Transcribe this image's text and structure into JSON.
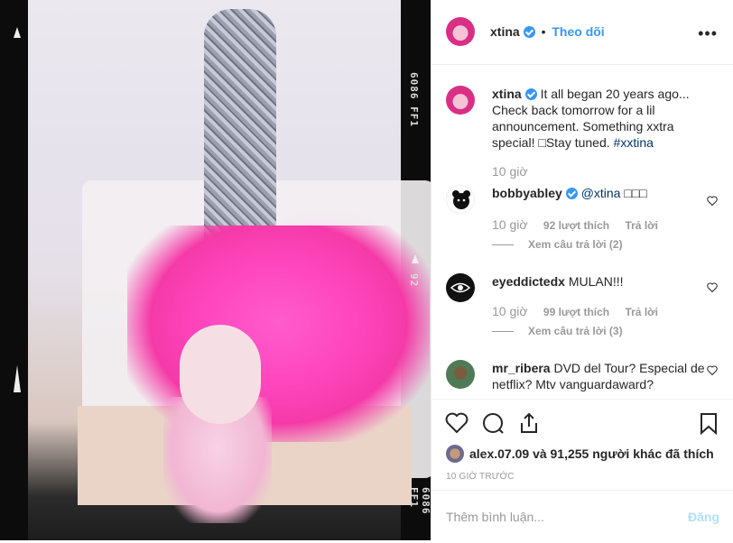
{
  "header": {
    "username": "xtina",
    "separator": "•",
    "follow_label": "Theo dõi",
    "more_label": "•••"
  },
  "film": {
    "top_code": "6086 FF1",
    "mid_code": "92",
    "bottom_code": "6086 FF1"
  },
  "caption": {
    "username": "xtina",
    "text": "It all began 20 years ago... Check back tomorrow for a lil announcement. Something xxtra special! □Stay tuned.",
    "hashtag": "#xxtina",
    "time": "10 giờ"
  },
  "comments": [
    {
      "username": "bobbyabley",
      "mention": "@xtina",
      "text": "□□□",
      "time": "10 giờ",
      "likes": "92 lượt thích",
      "reply_label": "Trả lời",
      "view_replies": "Xem câu trả lời (2)"
    },
    {
      "username": "eyeddictedx",
      "text": "MULAN!!!",
      "time": "10 giờ",
      "likes": "99 lượt thích",
      "reply_label": "Trả lời",
      "view_replies": "Xem câu trả lời (3)"
    },
    {
      "username": "mr_ribera",
      "text": "DVD del Tour? Especial de netflix? Mtv vanguardaward?"
    }
  ],
  "likes": {
    "first_user": "alex.07.09",
    "rest_text": "và 91,255 người khác đã thích"
  },
  "time_ago": "10 GIỜ TRƯỚC",
  "comment_box": {
    "placeholder": "Thêm bình luận...",
    "post_label": "Đăng"
  },
  "colors": {
    "link_blue": "#3897f0",
    "text": "#262626",
    "muted": "#999999"
  }
}
